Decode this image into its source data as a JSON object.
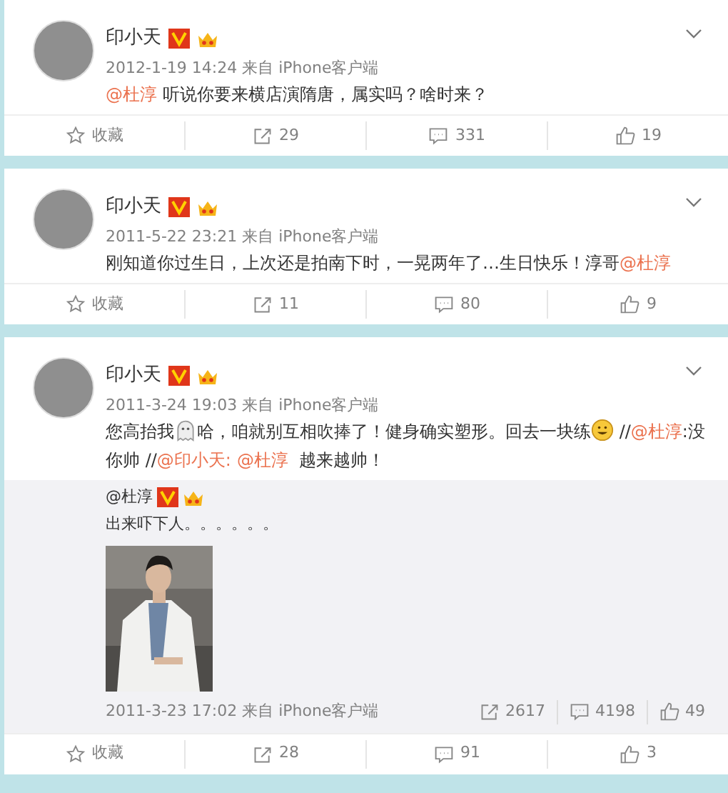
{
  "posts": [
    {
      "author": "印小天",
      "time": "2012-1-19 14:24 来自 iPhone客户端",
      "content": [
        {
          "kind": "mention",
          "text": "@杜淳"
        },
        {
          "kind": "text",
          "text": " 听说你要来横店演隋唐，属实吗？啥时来？"
        }
      ],
      "actions": [
        {
          "kind": "favorite",
          "label": "收藏"
        },
        {
          "kind": "repost",
          "label": "29"
        },
        {
          "kind": "comment",
          "label": "331"
        },
        {
          "kind": "like",
          "label": "19"
        }
      ]
    },
    {
      "author": "印小天",
      "time": "2011-5-22 23:21 来自 iPhone客户端",
      "content": [
        {
          "kind": "text",
          "text": "刚知道你过生日，上次还是拍南下时，一晃两年了…生日快乐！淳哥"
        },
        {
          "kind": "mention",
          "text": "@杜淳"
        }
      ],
      "actions": [
        {
          "kind": "favorite",
          "label": "收藏"
        },
        {
          "kind": "repost",
          "label": "11"
        },
        {
          "kind": "comment",
          "label": "80"
        },
        {
          "kind": "like",
          "label": "9"
        }
      ]
    },
    {
      "author": "印小天",
      "time": "2011-3-24 19:03 来自 iPhone客户端",
      "content": [
        {
          "kind": "text",
          "text": "您高抬我"
        },
        {
          "kind": "emoji"
        },
        {
          "kind": "text",
          "text": "哈，咱就别互相吹捧了！健身确实塑形。回去一块练"
        },
        {
          "kind": "smile"
        },
        {
          "kind": "text",
          "text": " //"
        },
        {
          "kind": "mention",
          "text": "@杜淳"
        },
        {
          "kind": "text",
          "text": ":没你帅 //"
        },
        {
          "kind": "mention",
          "text": "@印小天:"
        },
        {
          "kind": "mention",
          "text": "@杜淳"
        },
        {
          "kind": "text",
          "text": "  越来越帅！"
        }
      ],
      "retweet": {
        "author": "@杜淳",
        "text": "出来吓下人。。。。。。",
        "kind": "picture",
        "time": "2011-3-23 17:02 来自 iPhone客户端",
        "stats": [
          {
            "kind": "repost",
            "label": "2617"
          },
          {
            "kind": "comment",
            "label": "4198"
          },
          {
            "kind": "like",
            "label": "49"
          }
        ]
      },
      "actions": [
        {
          "kind": "favorite",
          "label": "收藏"
        },
        {
          "kind": "repost",
          "label": "28"
        },
        {
          "kind": "comment",
          "label": "91"
        },
        {
          "kind": "like",
          "label": "3"
        }
      ]
    }
  ]
}
